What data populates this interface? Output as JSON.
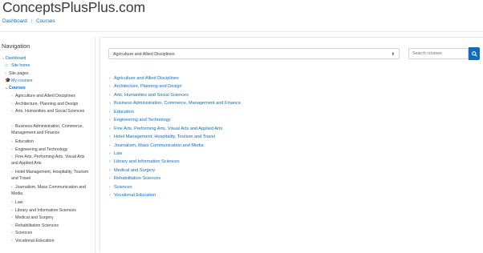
{
  "header": {
    "site_title": "ConceptsPlusPlus.com",
    "breadcrumb": {
      "home": "Dashboard",
      "separator": "/",
      "current": "Courses"
    }
  },
  "navigation": {
    "heading": "Navigation",
    "dashboard": "Dashboard",
    "site_home": "Site home",
    "site_pages": "Site pages",
    "my_courses": "My courses",
    "courses": "Courses",
    "categories": [
      "Agriculture and Allied Disciplines",
      "Architecture, Planning and Design",
      "Arts, Humanities and Social Sciences",
      "Business Administration, Commerce, Management and Finance",
      "Education",
      "Engineering and Technology",
      "Fine Arts, Performing Arts, Visual Arts and Applied Arts",
      "Hotel Management, Hospitality, Tourism and Travel",
      "Journalism, Mass Communication and Media",
      "Law",
      "Library and Information Sciences",
      "Medical and Surgery",
      "Rehabilitation Sciences",
      "Sciences",
      "Vocational Education"
    ]
  },
  "main": {
    "category_select": {
      "selected": "Agriculture and Allied Disciplines",
      "arrow_glyph": "⬍"
    },
    "search": {
      "placeholder": "Search courses"
    },
    "categories": [
      "Agriculture and Allied Disciplines",
      "Architecture, Planning and Design",
      "Arts, Humanities and Social Sciences",
      "Business Administration, Commerce, Management and Finance",
      "Education",
      "Engineering and Technology",
      "Fine Arts, Performing Arts, Visual Arts and Applied Arts",
      "Hotel Management, Hospitality, Tourism and Travel",
      "Journalism, Mass Communication and Media",
      "Law",
      "Library and Information Sciences",
      "Medical and Surgery",
      "Rehabilitation Sciences",
      "Sciences",
      "Vocational Education"
    ]
  },
  "icons": {
    "caret_right": "›",
    "caret_down": "⌄",
    "home": "home-icon",
    "graduation": "graduation-cap-icon",
    "search": "search-icon"
  },
  "colors": {
    "link": "#0f6cbf",
    "accent": "#0f6cbf",
    "text": "#373a3c",
    "border": "#ced4da"
  }
}
